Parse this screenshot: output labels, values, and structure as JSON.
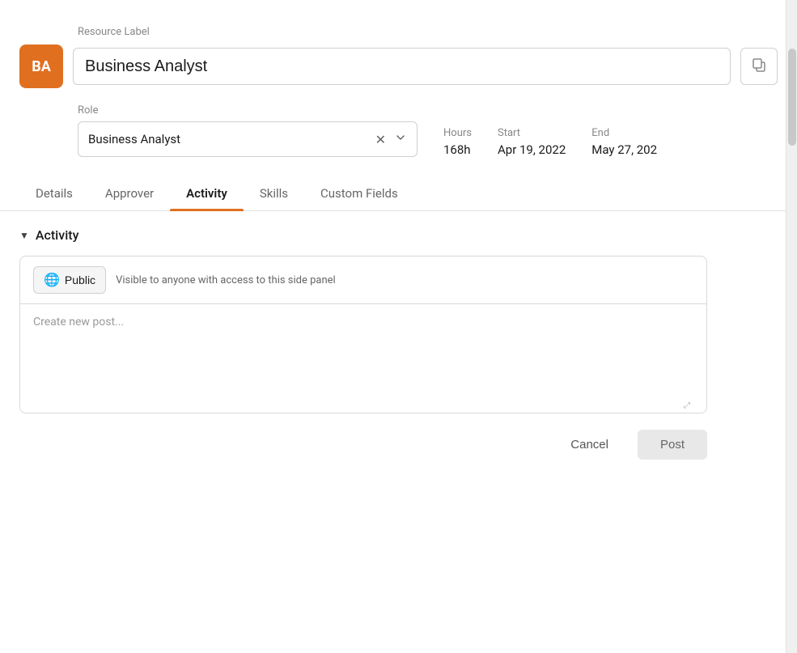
{
  "header": {
    "resource_label_text": "Resource Label",
    "avatar_initials": "BA",
    "resource_label_value": "Business Analyst",
    "copy_button_label": "Copy"
  },
  "role": {
    "label": "Role",
    "value": "Business Analyst"
  },
  "info": {
    "hours_label": "Hours",
    "hours_value": "168h",
    "start_label": "Start",
    "start_value": "Apr 19, 2022",
    "end_label": "End",
    "end_value": "May 27, 202"
  },
  "tabs": [
    {
      "id": "details",
      "label": "Details"
    },
    {
      "id": "approver",
      "label": "Approver"
    },
    {
      "id": "activity",
      "label": "Activity"
    },
    {
      "id": "skills",
      "label": "Skills"
    },
    {
      "id": "custom_fields",
      "label": "Custom Fields"
    }
  ],
  "activity": {
    "section_title": "Activity",
    "public_button_label": "Public",
    "visibility_text": "Visible to anyone with access to this side panel",
    "textarea_placeholder": "Create new post...",
    "cancel_label": "Cancel",
    "post_label": "Post"
  }
}
